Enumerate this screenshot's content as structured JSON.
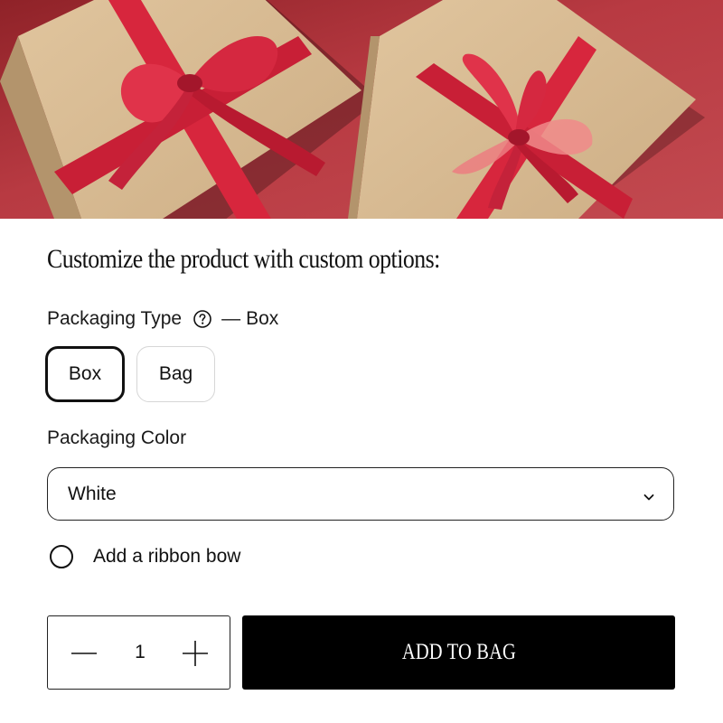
{
  "hero": {
    "image": "gift-boxes-with-red-ribbons"
  },
  "heading": "Customize the product with custom options:",
  "packaging_type": {
    "label": "Packaging Type",
    "help_icon": "question-circle-icon",
    "separator": "—",
    "selected": "Box",
    "options": [
      "Box",
      "Bag"
    ]
  },
  "packaging_color": {
    "label": "Packaging Color",
    "value": "White",
    "dropdown_icon": "chevron-down-icon"
  },
  "ribbon": {
    "label": "Add a ribbon bow",
    "checked": false
  },
  "quantity": {
    "value": "1",
    "decrement_icon": "minus-icon",
    "increment_icon": "plus-icon"
  },
  "cta": {
    "label": "ADD TO BAG"
  },
  "colors": {
    "background": "#ffffff",
    "hero_bg": "#b5393f",
    "ribbon": "#d7263d",
    "box": "#d9bd95",
    "button": "#000000"
  }
}
